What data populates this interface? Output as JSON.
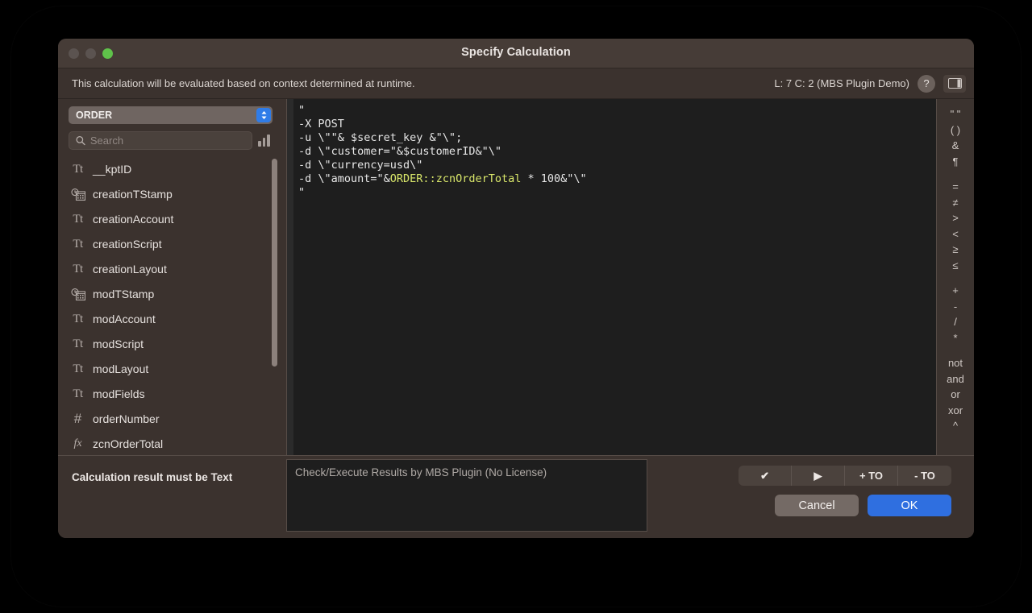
{
  "window": {
    "title": "Specify Calculation",
    "traffic_lights": [
      "close",
      "minimize",
      "zoom"
    ]
  },
  "context_bar": {
    "message": "This calculation will be evaluated based on context determined at runtime.",
    "cursor_position": "L: 7 C: 2 (MBS Plugin Demo)",
    "help_label": "?",
    "panel_toggle_icon": "sidebar-toggle-icon"
  },
  "sidebar": {
    "table_select": {
      "value": "ORDER",
      "stepper_icon": "up-down-chevron-icon"
    },
    "search": {
      "placeholder": "Search",
      "value": "",
      "icon": "search-icon"
    },
    "chart_button_icon": "bar-chart-icon",
    "fields": [
      {
        "name": "__kptID",
        "type_icon": "text-field-icon",
        "glyph": "Tt"
      },
      {
        "name": "creationTStamp",
        "type_icon": "timestamp-field-icon",
        "glyph": ""
      },
      {
        "name": "creationAccount",
        "type_icon": "text-field-icon",
        "glyph": "Tt"
      },
      {
        "name": "creationScript",
        "type_icon": "text-field-icon",
        "glyph": "Tt"
      },
      {
        "name": "creationLayout",
        "type_icon": "text-field-icon",
        "glyph": "Tt"
      },
      {
        "name": "modTStamp",
        "type_icon": "timestamp-field-icon",
        "glyph": ""
      },
      {
        "name": "modAccount",
        "type_icon": "text-field-icon",
        "glyph": "Tt"
      },
      {
        "name": "modScript",
        "type_icon": "text-field-icon",
        "glyph": "Tt"
      },
      {
        "name": "modLayout",
        "type_icon": "text-field-icon",
        "glyph": "Tt"
      },
      {
        "name": "modFields",
        "type_icon": "text-field-icon",
        "glyph": "Tt"
      },
      {
        "name": "orderNumber",
        "type_icon": "number-field-icon",
        "glyph": "#"
      },
      {
        "name": "zcnOrderTotal",
        "type_icon": "calculation-field-icon",
        "glyph": "fx"
      }
    ]
  },
  "editor": {
    "lines": [
      {
        "segments": [
          {
            "text": "\"",
            "token": "plain"
          }
        ]
      },
      {
        "segments": [
          {
            "text": "-X POST",
            "token": "plain"
          }
        ]
      },
      {
        "segments": [
          {
            "text": "-u \\\"\"& $secret_key &\"\\\";",
            "token": "plain"
          }
        ]
      },
      {
        "segments": [
          {
            "text": "-d \\\"customer=\"&$customerID&\"\\\"",
            "token": "plain"
          }
        ]
      },
      {
        "segments": [
          {
            "text": "-d \\\"currency=usd\\\"",
            "token": "plain"
          }
        ]
      },
      {
        "segments": [
          {
            "text": "-d \\\"amount=\"&",
            "token": "plain"
          },
          {
            "text": "ORDER::zcnOrderTotal",
            "token": "field"
          },
          {
            "text": " * 100&\"\\\"",
            "token": "plain"
          }
        ]
      },
      {
        "segments": [
          {
            "text": "\"",
            "token": "plain"
          }
        ]
      }
    ],
    "field_token_color": "#d8e66a",
    "background_color": "#1e1e1e"
  },
  "operators": {
    "groups": [
      [
        "\" \"",
        "( )",
        "&",
        "¶"
      ],
      [
        "=",
        "≠",
        ">",
        "<",
        "≥",
        "≤"
      ],
      [
        "+",
        "-",
        "/",
        "*"
      ],
      [
        "not",
        "and",
        "or",
        "xor",
        "^"
      ]
    ]
  },
  "footer": {
    "result_type_label": "Calculation result must be  Text",
    "results_placeholder": "Check/Execute Results by MBS Plugin (No License)",
    "segmented_buttons": [
      {
        "label": "✔",
        "name": "check-syntax-button"
      },
      {
        "label": "▶",
        "name": "execute-button"
      },
      {
        "label": "+ TO",
        "name": "increase-text-size-button"
      },
      {
        "label": "- TO",
        "name": "decrease-text-size-button"
      }
    ],
    "cancel_label": "Cancel",
    "ok_label": "OK",
    "ok_color": "#2f6fe0"
  }
}
